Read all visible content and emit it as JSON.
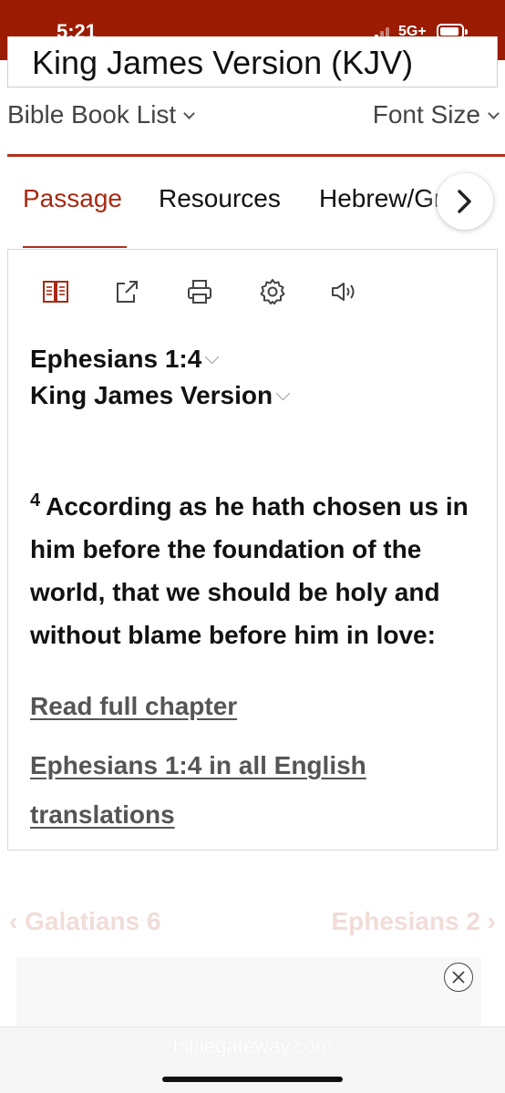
{
  "status_bar": {
    "time": "5:21",
    "network": "5G+",
    "bar_color": "#9b1c03"
  },
  "version_select": {
    "label": "King James Version (KJV)"
  },
  "top_nav": {
    "book_list": "Bible Book List",
    "font_size": "Font Size"
  },
  "tabs": [
    {
      "label": "Passage",
      "active": true
    },
    {
      "label": "Resources",
      "active": false
    },
    {
      "label": "Hebrew/Greek",
      "active": false
    }
  ],
  "toolbar": {
    "icons": [
      "parallel-view-icon",
      "share-icon",
      "print-icon",
      "settings-icon",
      "audio-icon"
    ]
  },
  "passage": {
    "reference": "Ephesians 1:4",
    "version": "King James Version",
    "verse_number": "4",
    "verse_text": "According as he hath chosen us in him before the foundation of the world, that we should be holy and without blame before him in love:",
    "link_full_chapter": "Read full chapter",
    "link_all_translations": "Ephesians 1:4 in all English translations"
  },
  "chapter_nav": {
    "prev": "Galatians 6",
    "next": "Ephesians 2"
  },
  "browser": {
    "url": "biblegateway.com"
  },
  "colors": {
    "accent": "#a62a12",
    "status_bar": "#9b1c03"
  }
}
